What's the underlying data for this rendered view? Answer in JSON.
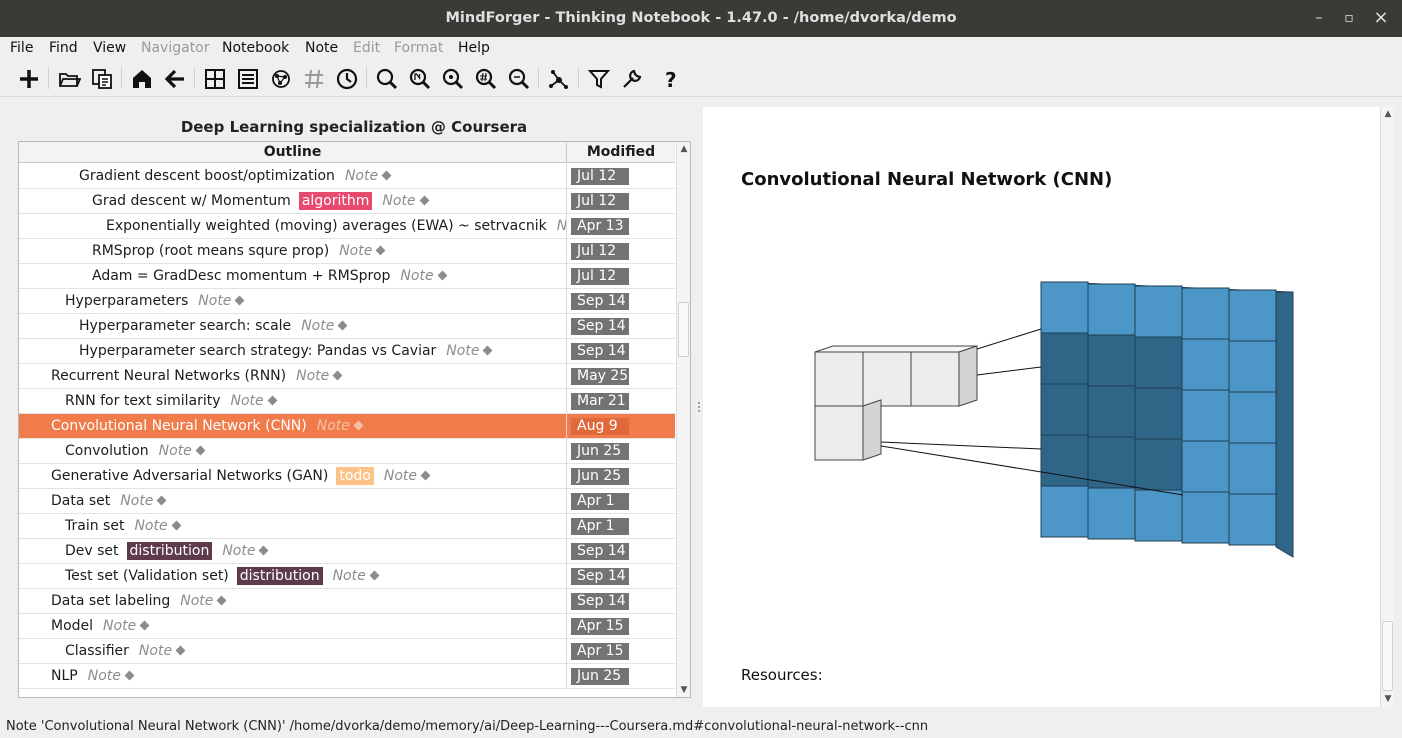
{
  "window": {
    "title": "MindForger - Thinking Notebook - 1.47.0 - /home/dvorka/demo",
    "minimize": "–",
    "maximize": "▫",
    "close": "×"
  },
  "menu": {
    "file": "File",
    "find": "Find",
    "view": "View",
    "navigator": "Navigator",
    "notebook": "Notebook",
    "note": "Note",
    "edit": "Edit",
    "format": "Format",
    "help": "Help"
  },
  "toolbar_icons": [
    "new-icon",
    "open-folder-icon",
    "recent-icon",
    "home-icon",
    "back-icon",
    "grid-icon",
    "list-icon",
    "graph-icon",
    "tags-icon",
    "clock-icon",
    "find-icon",
    "find-n-icon",
    "find-n2-icon",
    "find-tag-icon",
    "find-n3-icon",
    "navigator-icon",
    "filter-icon",
    "settings-icon",
    "help-icon"
  ],
  "notebook": {
    "title": "Deep Learning specialization @ Coursera",
    "col_outline": "Outline",
    "col_modified": "Modified",
    "note_label": "Note"
  },
  "rows": [
    {
      "title": "Gradient descent boost/optimization",
      "date": "Jul 12"
    },
    {
      "title": "Grad descent w/ Momentum",
      "tag": "algorithm",
      "date": "Jul 12"
    },
    {
      "title": "Exponentially weighted (moving) averages (EWA) ~ setrvacnik",
      "date": "Apr 13"
    },
    {
      "title": "RMSprop (root means squre prop)",
      "date": "Jul 12"
    },
    {
      "title": "Adam = GradDesc momentum + RMSprop",
      "date": "Jul 12"
    },
    {
      "title": "Hyperparameters",
      "date": "Sep 14"
    },
    {
      "title": "Hyperparameter search: scale",
      "date": "Sep 14"
    },
    {
      "title": "Hyperparameter search strategy: Pandas vs Caviar",
      "date": "Sep 14"
    },
    {
      "title": "Recurrent Neural Networks (RNN)",
      "date": "May 25"
    },
    {
      "title": "RNN for text similarity",
      "date": "Mar 21"
    },
    {
      "title": "Convolutional Neural Network (CNN)",
      "date": "Aug  9"
    },
    {
      "title": "Convolution",
      "date": "Jun 25"
    },
    {
      "title": "Generative Adversarial Networks (GAN)",
      "tag": "todo",
      "date": "Jun 25"
    },
    {
      "title": "Data set",
      "date": "Apr  1"
    },
    {
      "title": "Train set",
      "date": "Apr  1"
    },
    {
      "title": "Dev set",
      "tag": "distribution",
      "date": "Sep 14"
    },
    {
      "title": "Test set (Validation set)",
      "tag": "distribution",
      "date": "Sep 14"
    },
    {
      "title": "Data set labeling",
      "date": "Sep 14"
    },
    {
      "title": "Model",
      "date": "Apr 15"
    },
    {
      "title": "Classifier",
      "date": "Apr 15"
    },
    {
      "title": "NLP",
      "date": "Jun 25"
    }
  ],
  "colors": {
    "selected_row": "#f07c4c",
    "tag_algorithm": "#e84a6f",
    "tag_todo": "#fcc28a",
    "tag_distribution": "#5d3a4e",
    "cnn_blue": "#4d97c8",
    "cnn_dark": "#2f6688"
  },
  "note_view": {
    "heading": "Convolutional Neural Network (CNN)",
    "resources_label": "Resources:"
  },
  "status": {
    "text": "Note 'Convolutional Neural Network (CNN)'   /home/dvorka/demo/memory/ai/Deep-Learning---Coursera.md#convolutional-neural-network--cnn"
  }
}
